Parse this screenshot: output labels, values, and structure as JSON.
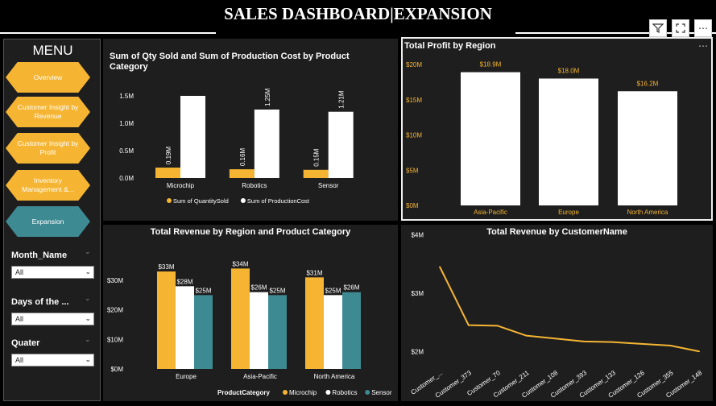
{
  "header": {
    "title": "SALES DASHBOARD|EXPANSION"
  },
  "menu": {
    "title": "MENU",
    "items": [
      {
        "label": "Overview"
      },
      {
        "label": "Customer Insight by Revenue"
      },
      {
        "label": "Customer Insight by Profit"
      },
      {
        "label": "Inventory Management &..."
      },
      {
        "label": "Expansion"
      }
    ]
  },
  "slicers": [
    {
      "label": "Month_Name",
      "value": "All"
    },
    {
      "label": "Days of the ...",
      "value": "All"
    },
    {
      "label": "Quater",
      "value": "All"
    }
  ],
  "colors": {
    "accent": "#f5b533",
    "teal": "#3e8a93",
    "white": "#ffffff",
    "panel": "#1e1e1e"
  },
  "icons": [
    "filter-icon",
    "expand-icon",
    "more-options-icon"
  ],
  "chart_data": [
    {
      "type": "bar",
      "title": "Sum of Qty Sold and Sum of Production Cost by Product Category",
      "categories": [
        "Microchip",
        "Robotics",
        "Sensor"
      ],
      "series": [
        {
          "name": "Sum of QuantitySold",
          "values": [
            190000,
            160000,
            150000
          ],
          "labels": [
            "0.19M",
            "0.16M",
            "0.15M"
          ],
          "color": "#f5b533"
        },
        {
          "name": "Sum of ProductionCost",
          "values": [
            1500000,
            1250000,
            1210000
          ],
          "labels": [
            "",
            "1.25M",
            "1.21M"
          ],
          "color": "#ffffff"
        }
      ],
      "yticks": [
        "0.0M",
        "0.5M",
        "1.0M",
        "1.5M"
      ],
      "ylim": [
        0,
        1600000
      ]
    },
    {
      "type": "bar",
      "title": "Total Profit by Region",
      "categories": [
        "Asia-Pacific",
        "Europe",
        "North America"
      ],
      "values": [
        18900000,
        18000000,
        16200000
      ],
      "labels": [
        "$18.9M",
        "$18.0M",
        "$16.2M"
      ],
      "yticks": [
        "$0M",
        "$5M",
        "$10M",
        "$15M",
        "$20M"
      ],
      "ylim": [
        0,
        20000000
      ]
    },
    {
      "type": "bar",
      "title": "Total Revenue by Region and Product Category",
      "categories": [
        "Europe",
        "Asia-Pacific",
        "North America"
      ],
      "legend_title": "ProductCategory",
      "series": [
        {
          "name": "Microchip",
          "values": [
            33000000,
            34000000,
            31000000
          ],
          "labels": [
            "$33M",
            "$34M",
            "$31M"
          ],
          "color": "#f5b533"
        },
        {
          "name": "Robotics",
          "values": [
            28000000,
            26000000,
            25000000
          ],
          "labels": [
            "$28M",
            "$26M",
            "$25M"
          ],
          "color": "#ffffff"
        },
        {
          "name": "Sensor",
          "values": [
            25000000,
            25000000,
            26000000
          ],
          "labels": [
            "$25M",
            "$25M",
            "$26M"
          ],
          "color": "#3e8a93"
        }
      ],
      "yticks": [
        "$0M",
        "$10M",
        "$20M",
        "$30M"
      ],
      "ylim": [
        0,
        36000000
      ]
    },
    {
      "type": "line",
      "title": "Total Revenue by CustomerName",
      "categories": [
        "Customer_...",
        "Customer_373",
        "Customer_70",
        "Customer_211",
        "Customer_108",
        "Customer_393",
        "Customer_133",
        "Customer_126",
        "Customer_355",
        "Customer_148"
      ],
      "values": [
        3450000,
        2450000,
        2440000,
        2270000,
        2220000,
        2170000,
        2160000,
        2130000,
        2100000,
        2000000
      ],
      "yticks": [
        "$2M",
        "$3M",
        "$4M"
      ],
      "ylim": [
        1700000,
        4100000
      ],
      "color": "#f5b533"
    }
  ]
}
